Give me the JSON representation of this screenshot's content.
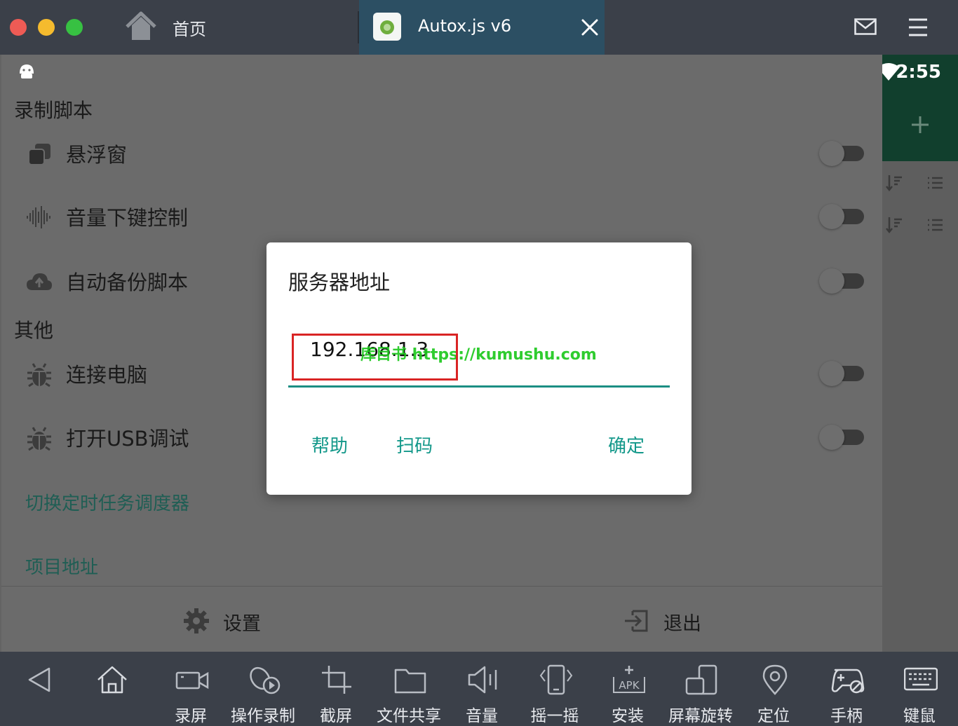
{
  "window": {
    "home_tab_label": "首页",
    "app_tab_label": "Autox.js v6"
  },
  "status_bar": {
    "time": "2:55"
  },
  "drawer": {
    "section_record": "录制脚本",
    "section_other": "其他",
    "rows": [
      {
        "label": "悬浮窗",
        "icon": "floating-window-icon",
        "on": false
      },
      {
        "label": "音量下键控制",
        "icon": "volume-wave-icon",
        "on": false
      },
      {
        "label": "自动备份脚本",
        "icon": "cloud-upload-icon",
        "on": false
      },
      {
        "label": "连接电脑",
        "icon": "bug-icon",
        "on": false
      },
      {
        "label": "打开USB调试",
        "icon": "bug-icon",
        "on": false
      }
    ],
    "link_scheduler": "切换定时任务调度器",
    "link_project": "项目地址",
    "settings_label": "设置",
    "exit_label": "退出"
  },
  "dialog": {
    "title": "服务器地址",
    "input_value": "192.168.1.3",
    "watermark": "库目书 https://kumushu.com",
    "help_label": "帮助",
    "scan_label": "扫码",
    "confirm_label": "确定"
  },
  "toolbar": {
    "items": [
      "录屏",
      "操作录制",
      "截屏",
      "文件共享",
      "音量",
      "摇一摇",
      "安装",
      "屏幕旋转",
      "定位",
      "手柄",
      "键鼠"
    ]
  },
  "colors": {
    "accent": "#13988a",
    "underline": "#1b8e83",
    "highlight_box": "#d92424",
    "watermark": "#1ec81e",
    "fab_panel": "#113f2d"
  }
}
